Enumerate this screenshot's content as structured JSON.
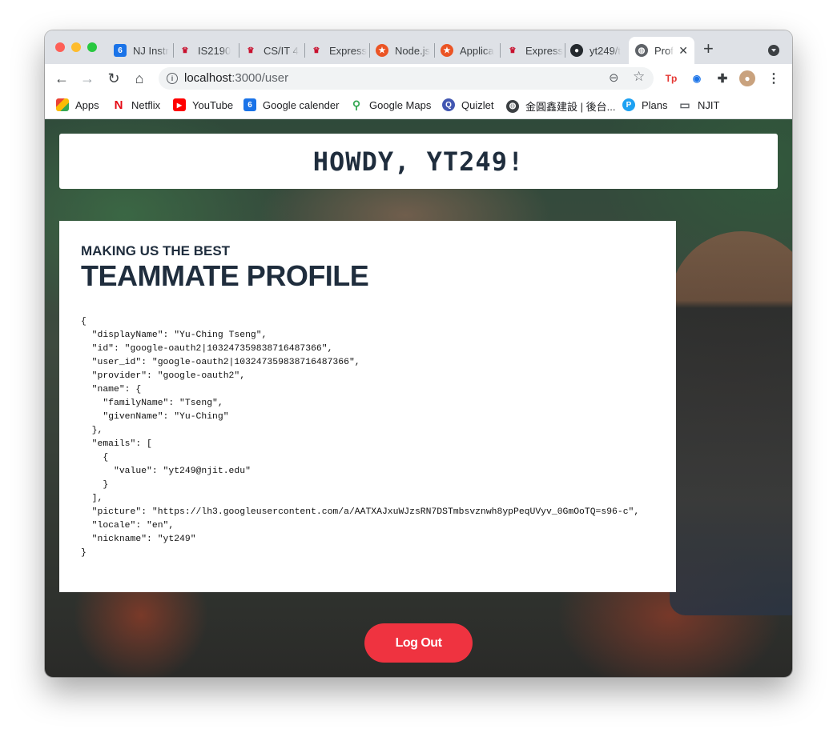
{
  "tabs": [
    {
      "label": "NJ Instr",
      "icon": "calendar-6-icon"
    },
    {
      "label": "IS2190",
      "icon": "njit-logo-icon"
    },
    {
      "label": "CS/IT 4",
      "icon": "njit-logo-icon"
    },
    {
      "label": "Express",
      "icon": "njit-logo-icon"
    },
    {
      "label": "Node.js",
      "icon": "auth0-icon"
    },
    {
      "label": "Applica",
      "icon": "auth0-icon"
    },
    {
      "label": "Express",
      "icon": "njit-logo-icon"
    },
    {
      "label": "yt249/t",
      "icon": "github-icon"
    },
    {
      "label": "Prof",
      "icon": "globe-icon",
      "active": true
    }
  ],
  "address_bar": {
    "host": "localhost",
    "path": ":3000/user"
  },
  "bookmarks": [
    {
      "label": "Apps",
      "icon": "apps-grid-icon"
    },
    {
      "label": "Netflix",
      "icon": "netflix-icon"
    },
    {
      "label": "YouTube",
      "icon": "youtube-icon"
    },
    {
      "label": "Google calender",
      "icon": "google-calendar-icon"
    },
    {
      "label": "Google Maps",
      "icon": "google-maps-icon"
    },
    {
      "label": "Quizlet",
      "icon": "quizlet-icon"
    },
    {
      "label": "金圓鑫建設 | 後台...",
      "icon": "globe-icon"
    },
    {
      "label": "Plans",
      "icon": "plans-icon"
    },
    {
      "label": "NJIT",
      "icon": "folder-icon"
    }
  ],
  "page": {
    "greeting": "HOWDY, YT249!",
    "eyebrow": "MAKING US THE BEST",
    "title": "TEAMMATE PROFILE",
    "profile_json": "{\n  \"displayName\": \"Yu-Ching Tseng\",\n  \"id\": \"google-oauth2|103247359838716487366\",\n  \"user_id\": \"google-oauth2|103247359838716487366\",\n  \"provider\": \"google-oauth2\",\n  \"name\": {\n    \"familyName\": \"Tseng\",\n    \"givenName\": \"Yu-Ching\"\n  },\n  \"emails\": [\n    {\n      \"value\": \"yt249@njit.edu\"\n    }\n  ],\n  \"picture\": \"https://lh3.googleusercontent.com/a/AATXAJxuWJzsRN7DSTmbsvznwh8ypPeqUVyv_0GmOoTQ=s96-c\",\n  \"locale\": \"en\",\n  \"nickname\": \"yt249\"\n}",
    "logout_label": "Log Out"
  },
  "colors": {
    "accent": "#ef3340",
    "heading": "#1f2d3d"
  }
}
